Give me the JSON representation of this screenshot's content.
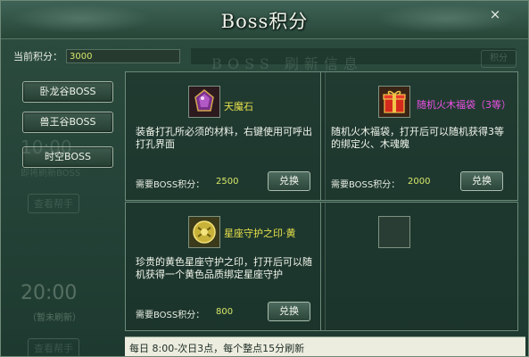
{
  "window": {
    "title": "Boss积分",
    "close_glyph": "×"
  },
  "score": {
    "label": "当前积分：",
    "value": "3000"
  },
  "ghost": {
    "banner": "BOSS 刷新信息",
    "right_button": "积分",
    "time_1": "10:00",
    "sub_1": "即将刷新BOSS",
    "help_1": "查看帮手",
    "time_2": "20:00",
    "sub_2": "（暂未刷新）",
    "help_2": "查看帮手"
  },
  "tabs": [
    {
      "label": "卧龙谷BOSS"
    },
    {
      "label": "兽王谷BOSS"
    },
    {
      "label": "时空BOSS"
    }
  ],
  "items": [
    {
      "name": "天魔石",
      "name_color": "#e8e24a",
      "icon": "demon-stone-icon",
      "desc": "装备打孔所必须的材料，右键使用可呼出打孔界面",
      "cost_label": "需要BOSS积分：",
      "cost": "2500",
      "button": "兑换"
    },
    {
      "name": "随机火木福袋（3等）",
      "name_color": "#ee52e6",
      "icon": "gift-bag-icon",
      "desc": "随机火木福袋，打开后可以随机获得3等的绑定火、木魂魄",
      "cost_label": "需要BOSS积分：",
      "cost": "2000",
      "button": "兑换"
    },
    {
      "name": "星座守护之印·黄",
      "name_color": "#e8e24a",
      "icon": "zodiac-seal-icon",
      "desc": "珍贵的黄色星座守护之印，打开后可以随机获得一个黄色品质绑定星座守护",
      "cost_label": "需要BOSS积分：",
      "cost": "800",
      "button": "兑换"
    }
  ],
  "footer": {
    "text": "每日 8:00-次日3点，每个整点15分刷新"
  }
}
